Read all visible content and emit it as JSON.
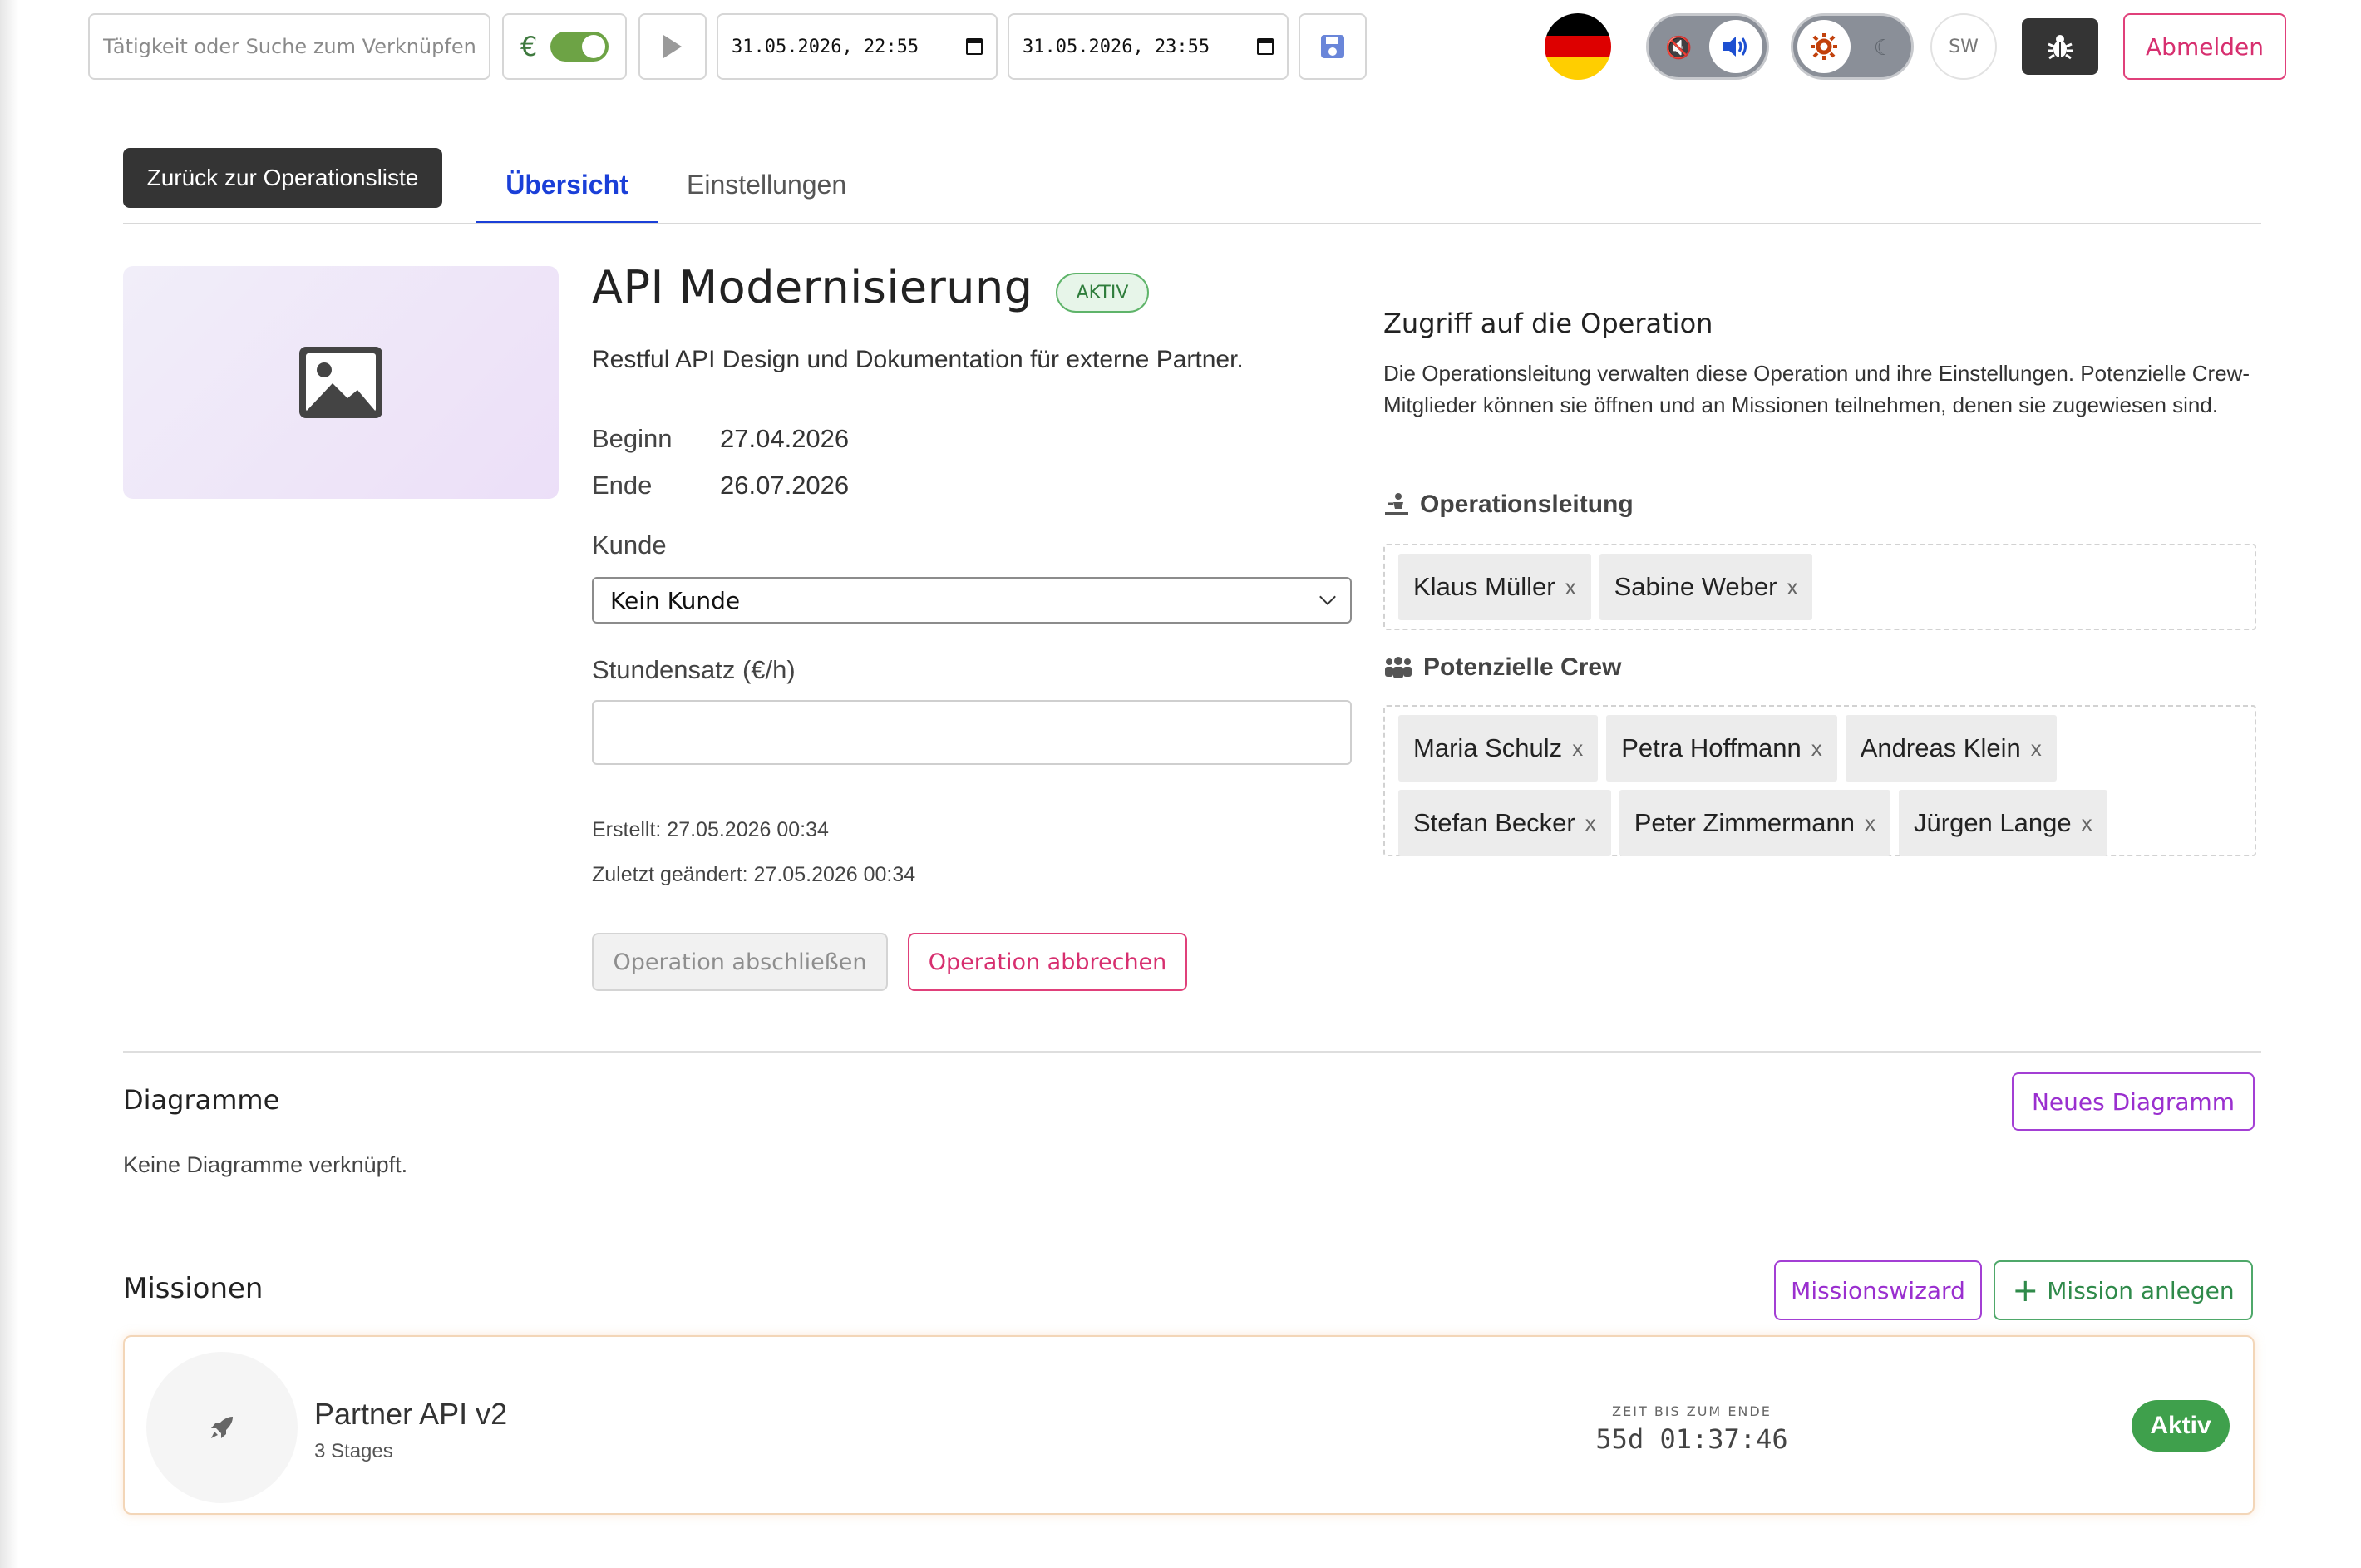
{
  "topbar": {
    "search_placeholder": "Tätigkeit oder Suche zum Verknüpfen",
    "currency_symbol": "€",
    "start_datetime": "31.05.2026, 22:55",
    "end_datetime": "31.05.2026, 23:55",
    "language_flag": "de-flag",
    "grayscale_label": "SW",
    "logout_label": "Abmelden"
  },
  "tabs": {
    "back_label": "Zurück zur Operationsliste",
    "overview_label": "Übersicht",
    "settings_label": "Einstellungen"
  },
  "operation": {
    "title": "API Modernisierung",
    "status_badge": "AKTIV",
    "description": "Restful API Design und Dokumentation für externe Partner.",
    "begin_label": "Beginn",
    "begin_value": "27.04.2026",
    "end_label": "Ende",
    "end_value": "26.07.2026",
    "customer_label": "Kunde",
    "customer_selected": "Kein Kunde",
    "rate_label": "Stundensatz (€/h)",
    "rate_value": "",
    "created": "Erstellt: 27.05.2026 00:34",
    "modified": "Zuletzt geändert: 27.05.2026 00:34",
    "close_button": "Operation abschließen",
    "cancel_button": "Operation abbrechen"
  },
  "access": {
    "heading": "Zugriff auf die Operation",
    "text": "Die Operationsleitung verwalten diese Operation und ihre Einstellungen. Potenzielle Crew-Mitglieder können sie öffnen und an Missionen teilnehmen, denen sie zugewiesen sind.",
    "leads_heading": "Operationsleitung",
    "leads": [
      "Klaus Müller",
      "Sabine Weber"
    ],
    "crew_heading": "Potenzielle Crew",
    "crew": [
      "Maria Schulz",
      "Petra Hoffmann",
      "Andreas Klein",
      "Stefan Becker",
      "Peter Zimmermann",
      "Jürgen Lange"
    ],
    "remove_symbol": "x"
  },
  "diagrams": {
    "heading": "Diagramme",
    "new_button": "Neues Diagramm",
    "empty_text": "Keine Diagramme verknüpft."
  },
  "missions": {
    "heading": "Missionen",
    "wizard_button": "Missionswizard",
    "add_button": "Mission anlegen",
    "items": [
      {
        "name": "Partner API v2",
        "subtitle": "3 Stages",
        "timer_label": "ZEIT BIS ZUM ENDE",
        "timer_value": "55d 01:37:46",
        "status": "Aktiv"
      }
    ]
  },
  "colors": {
    "accent_blue": "#1a3fd8",
    "danger_pink": "#d72f6f",
    "purple": "#9a2fcf",
    "success_green": "#3fa04c"
  }
}
